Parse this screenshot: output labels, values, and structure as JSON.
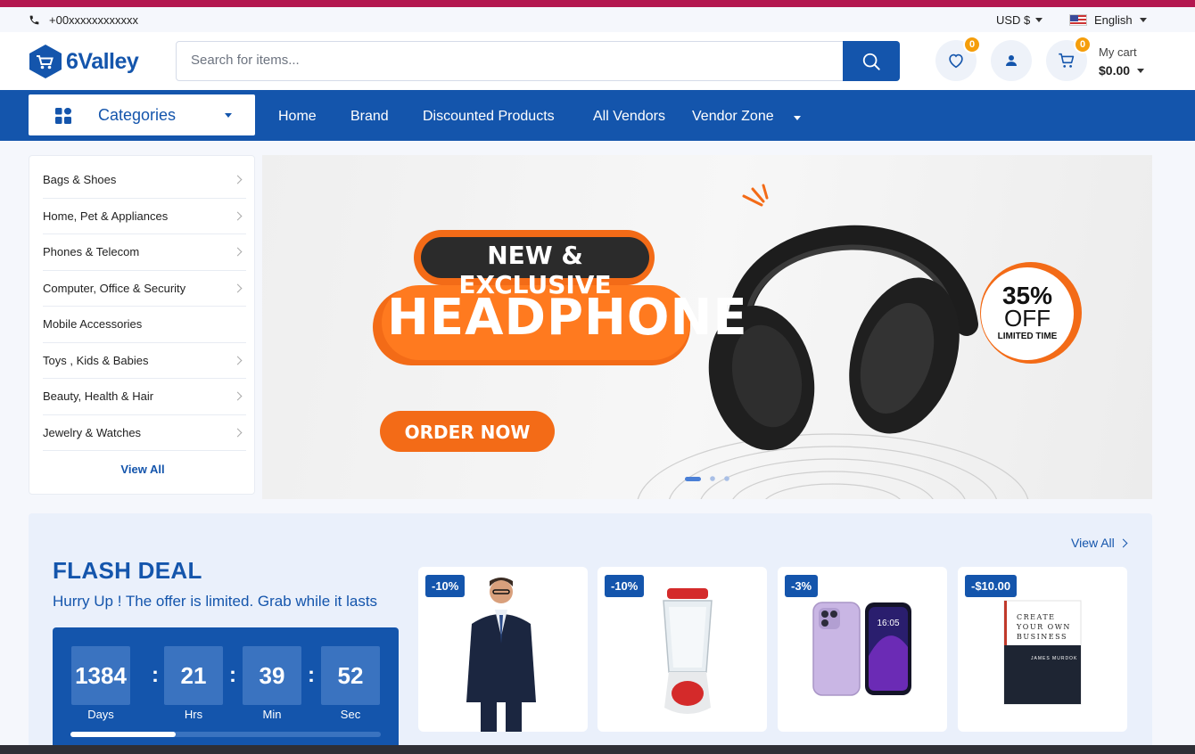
{
  "topbar": {
    "phone": "+00xxxxxxxxxxxx",
    "currency": "USD $",
    "language": "English"
  },
  "header": {
    "logo": "6Valley",
    "search_placeholder": "Search for items...",
    "wishlist_count": "0",
    "cart_count": "0",
    "cart_label": "My cart",
    "cart_total": "$0.00"
  },
  "nav": {
    "categories_label": "Categories",
    "items": [
      "Home",
      "Brand",
      "Discounted Products",
      "All Vendors",
      "Vendor Zone"
    ]
  },
  "sidebar": {
    "items": [
      {
        "label": "Bags & Shoes"
      },
      {
        "label": "Home, Pet & Appliances"
      },
      {
        "label": "Phones & Telecom"
      },
      {
        "label": "Computer, Office & Security"
      },
      {
        "label": "Mobile Accessories"
      },
      {
        "label": "Toys , Kids & Babies"
      },
      {
        "label": "Beauty, Health & Hair"
      },
      {
        "label": "Jewelry & Watches"
      }
    ],
    "view_all": "View All"
  },
  "banner": {
    "tag": "NEW & EXCLUSIVE",
    "headline": "HEADPHONE",
    "cta": "ORDER NOW",
    "offer_pct": "35%",
    "offer_word": "OFF",
    "offer_note": "LIMITED TIME",
    "slides": 3,
    "active_slide": 1
  },
  "flash": {
    "title": "FLASH DEAL",
    "subtitle": "Hurry Up ! The offer is limited. Grab while it lasts",
    "view_all": "View All",
    "timer": {
      "days": "1384",
      "hours": "21",
      "minutes": "39",
      "seconds": "52",
      "days_label": "Days",
      "hours_label": "Hrs",
      "minutes_label": "Min",
      "seconds_label": "Sec",
      "progress": 0.34
    },
    "products": [
      {
        "discount": "-10%"
      },
      {
        "discount": "-10%"
      },
      {
        "discount": "-3%"
      },
      {
        "discount": "-$10.00"
      }
    ],
    "book_lines": [
      "CREATE",
      "YOUR OWN",
      "BUSINESS",
      "JAMES MURDOK"
    ],
    "phone_time": "16:05"
  },
  "colors": {
    "primary": "#1455ac",
    "accent": "#b3174f",
    "badge": "#f59e0b",
    "orange": "#f36b17"
  }
}
